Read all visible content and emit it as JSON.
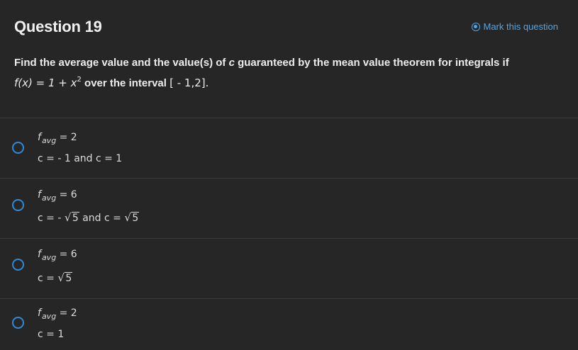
{
  "question": {
    "title": "Question 19",
    "mark_label": "Mark this question",
    "stem_text": "Find the average value and the value(s) of c guaranteed by the mean value theorem for integrals if",
    "stem_prefix": "Find the average value and the value(s) of ",
    "stem_c": "c",
    "stem_suffix": " guaranteed by the mean value theorem for integrals if",
    "function_lhs": "f(x) = 1 + x",
    "function_exp": "2",
    "over_text": "over the interval",
    "interval": "[ - 1,2]."
  },
  "choices": [
    {
      "favg_label": "f",
      "favg_sub": "avg",
      "favg_value": "= 2",
      "c_text": "c = - 1 and c = 1"
    },
    {
      "favg_label": "f",
      "favg_sub": "avg",
      "favg_value": "= 6",
      "c_pre": "c = -",
      "c_rad1": "5",
      "c_mid": " and c =",
      "c_rad2": "5"
    },
    {
      "favg_label": "f",
      "favg_sub": "avg",
      "favg_value": "= 6",
      "c_pre": "c =",
      "c_rad1": "5"
    },
    {
      "favg_label": "f",
      "favg_sub": "avg",
      "favg_value": "= 2",
      "c_text": "c = 1"
    }
  ],
  "colors": {
    "accent": "#4fa6e8",
    "radio": "#2f8ad6",
    "background": "#262626"
  }
}
